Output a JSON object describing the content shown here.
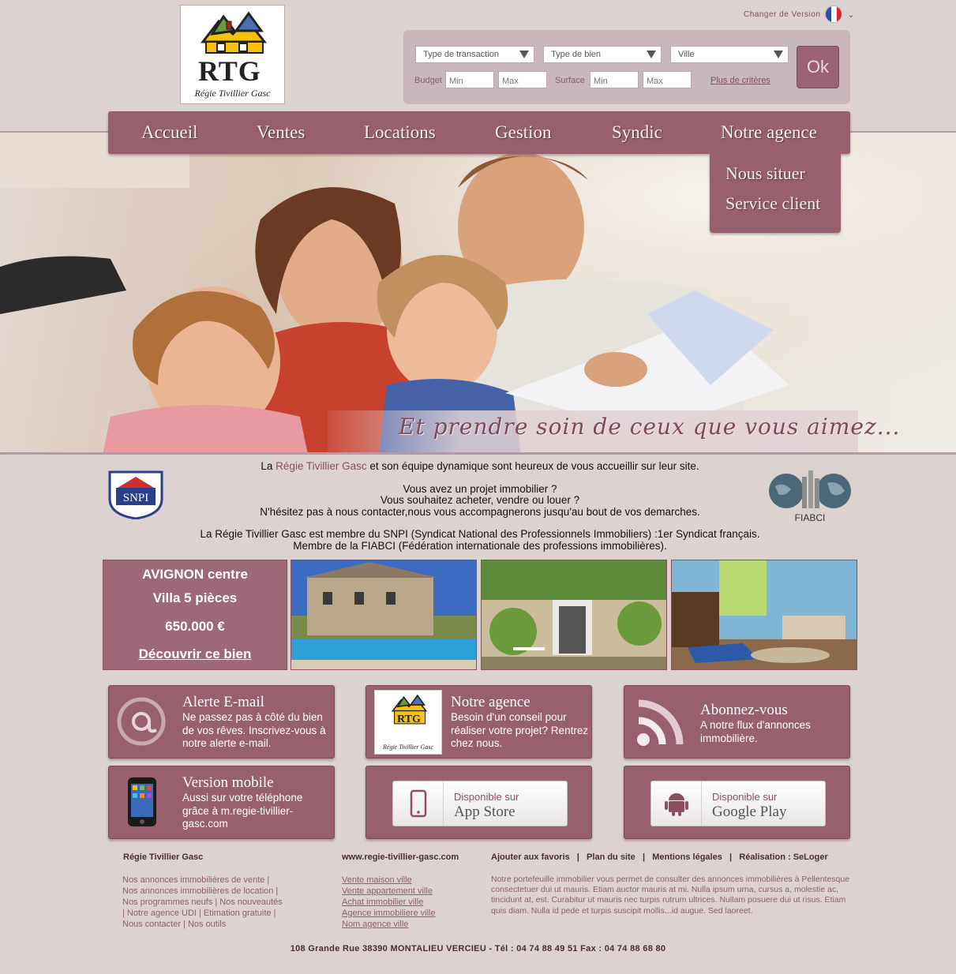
{
  "header": {
    "logo_text": "RTG",
    "logo_caption": "Régie Tivillier Gasc",
    "language_label": "Changer de Version"
  },
  "search": {
    "transaction": "Type de transaction",
    "property_type": "Type de bien",
    "city": "Ville",
    "budget_label": "Budget",
    "surface_label": "Surface",
    "min_placeholder": "Min",
    "max_placeholder": "Max",
    "more_criteria": "Plus de critères",
    "ok_label": "Ok"
  },
  "nav": {
    "items": [
      "Accueil",
      "Ventes",
      "Locations",
      "Gestion",
      "Syndic",
      "Notre agence"
    ],
    "dropdown": [
      "Nous situer",
      "Service client"
    ]
  },
  "hero": {
    "slogan": "Et prendre soin de ceux que vous aimez..."
  },
  "intro": {
    "line1_pre": "La ",
    "line1_highlight": "Régie Tivillier Gasc",
    "line1_post": " et son équipe dynamique sont heureux de vous accueillir sur leur site.",
    "line2": "Vous avez un projet immobilier ?",
    "line3": "Vous souhaitez acheter, vendre ou louer ?",
    "line4": "N'hésitez pas à nous contacter,nous vous accompagnerons jusqu'au bout de vos demarches.",
    "line5": "La Régie Tivillier Gasc est membre du SNPI (Syndicat National des Professionnels Immobiliers) :1er Syndicat français.",
    "line6": "Membre de la FIABCI (Fédération internationale des professions immobilières).",
    "snpi_label": "SNPI",
    "fiabci_label": "FIABCI"
  },
  "featured": {
    "location": "AVIGNON centre",
    "type": "Villa 5 pièces",
    "price": "650.000 €",
    "cta": "Découvrir ce bien"
  },
  "boxes": {
    "alert_title": "Alerte E-mail",
    "alert_text": "Ne passez pas à côté du bien de vos rêves. Inscrivez-vous à notre alerte e-mail.",
    "agency_title": "Notre agence",
    "agency_text": "Besoin d'un conseil pour réaliser votre projet? Rentrez chez nous.",
    "rss_title": "Abonnez-vous",
    "rss_text": "A notre flux d'annonces immobilière.",
    "mobile_title": "Version mobile",
    "mobile_text": "Aussi sur votre téléphone grâce à m.regie-tivillier-gasc.com",
    "appstore_l1": "Disponible sur",
    "appstore_l2": "App Store",
    "gplay_l1": "Disponible sur",
    "gplay_l2": "Google Play"
  },
  "footer": {
    "col1_title": "Régie Tivillier Gasc",
    "col1_links": [
      "Nos annonces immobilières de vente |",
      "Nos annonces immobilières de location |",
      "Nos programmes neufs | Nos nouveautés",
      "| Notre agence UDI | Etimation gratuite |",
      "Nous contacter | Nos outils"
    ],
    "col2_title": "www.regie-tivillier-gasc.com",
    "col2_links": [
      "Vente maison ville",
      "Vente appartement ville",
      "Achat immobilier ville",
      "Agence immobiliere ville",
      "Nom agence ville"
    ],
    "col3_title": "Ajouter aux favoris   |   Plan du site   |   Mentions légales   |   Réalisation : SeLoger",
    "col3_text": "Notre portefeuille immobilier vous permet de consulter des annonces immobilières à Pellentesque consectetuer dui ut mauris. Etiam auctor mauris at mi. Nulla ipsum urna, cursus a, molestie ac, tincidunt at, est. Curabitur ut mauris nec turpis rutrum ultrices. Nullam posuere dui ut risus. Etiam quis diam. Nulla id pede et turpis suscipit mollis...id augue. Sed laoreet.",
    "address": "108 Grande Rue 38390 MONTALIEU VERCIEU  -  Tél : 04 74 88 49 51  Fax : 04 74 88 68 80"
  },
  "colors": {
    "accent": "#98606f",
    "background": "#dcd2cf",
    "search_panel": "#c9b8bb"
  }
}
